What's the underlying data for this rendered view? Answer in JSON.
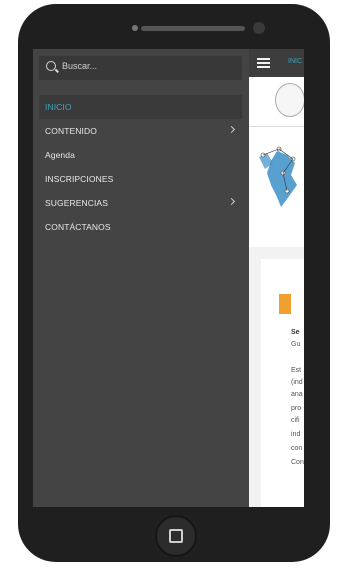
{
  "search": {
    "placeholder": "Buscar..."
  },
  "menu": {
    "items": [
      {
        "label": "INICIO",
        "active": true,
        "has_children": false
      },
      {
        "label": "CONTENIDO",
        "active": false,
        "has_children": true
      },
      {
        "label": "Agenda",
        "active": false,
        "has_children": false
      },
      {
        "label": "INSCRIPCIONES",
        "active": false,
        "has_children": false
      },
      {
        "label": "SUGERENCIAS",
        "active": false,
        "has_children": true
      },
      {
        "label": "CONTÁCTANOS",
        "active": false,
        "has_children": false
      }
    ]
  },
  "topbar": {
    "text": "INIC"
  },
  "content": {
    "lines": [
      "Se",
      "Gu",
      "Est",
      "(ind",
      "ana",
      "pro",
      "cifi",
      "ind",
      "con",
      "Con"
    ]
  },
  "colors": {
    "accent": "#3ea6b8",
    "drawer_bg": "#444444",
    "orange": "#f0a030"
  }
}
